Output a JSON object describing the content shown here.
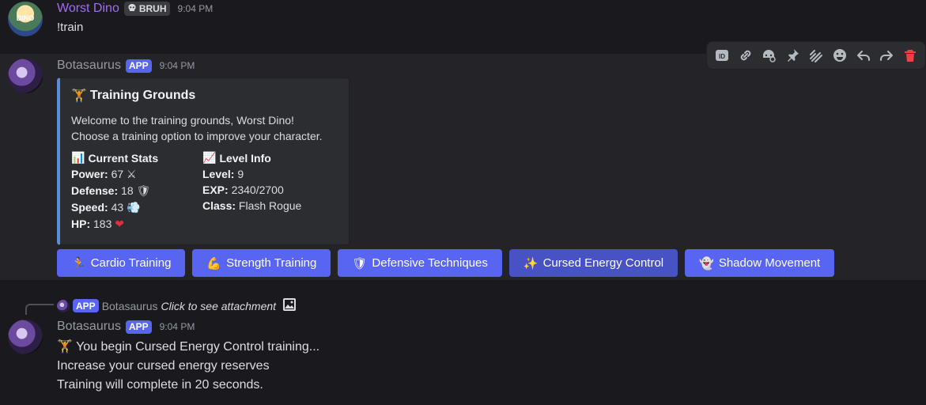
{
  "message1": {
    "username": "Worst Dino",
    "tag_icon": "skull-icon",
    "tag_label": "BRUH",
    "timestamp": "9:04 PM",
    "text": "!train",
    "username_color": "#a56bf5"
  },
  "toolbar": {
    "icons": [
      "id-icon",
      "link-icon",
      "reply-thread-icon",
      "pin-icon",
      "create-thread-icon",
      "add-reaction-icon",
      "reply-icon",
      "forward-icon",
      "delete-icon"
    ]
  },
  "message2": {
    "username": "Botasaurus",
    "app_badge": "APP",
    "timestamp": "9:04 PM",
    "embed": {
      "accent_color": "#5b8dd9",
      "title_emoji": "🏋",
      "title": "Training Grounds",
      "desc_line1": "Welcome to the training grounds, Worst Dino!",
      "desc_line2": "Choose a training option to improve your character.",
      "stats": {
        "emoji": "📊",
        "name": "Current Stats",
        "power_label": "Power:",
        "power_value": "67",
        "power_emoji": "⚔",
        "defense_label": "Defense:",
        "defense_value": "18",
        "defense_emoji": "🛡",
        "speed_label": "Speed:",
        "speed_value": "43",
        "speed_emoji": "💨",
        "hp_label": "HP:",
        "hp_value": "183",
        "hp_emoji": "❤"
      },
      "level": {
        "emoji": "📈",
        "name": "Level Info",
        "level_label": "Level:",
        "level_value": "9",
        "exp_label": "EXP:",
        "exp_value": "2340/2700",
        "class_label": "Class:",
        "class_value": "Flash Rogue"
      }
    },
    "buttons": [
      {
        "emoji": "🏃",
        "label": "Cardio Training"
      },
      {
        "emoji": "💪",
        "label": "Strength Training"
      },
      {
        "emoji": "🛡",
        "label": "Defensive Techniques"
      },
      {
        "emoji": "✨",
        "label": "Cursed Energy Control"
      },
      {
        "emoji": "👻",
        "label": "Shadow Movement"
      }
    ],
    "button_color": "#5865f2"
  },
  "message3": {
    "reply": {
      "app_badge": "APP",
      "username": "Botasaurus",
      "text": "Click to see attachment",
      "icon": "image-icon"
    },
    "username": "Botasaurus",
    "app_badge": "APP",
    "timestamp": "9:04 PM",
    "line1_emoji": "🏋",
    "line1": "You begin Cursed Energy Control training...",
    "line2": "Increase your cursed energy reserves",
    "line3": "Training will complete in 20 seconds."
  }
}
